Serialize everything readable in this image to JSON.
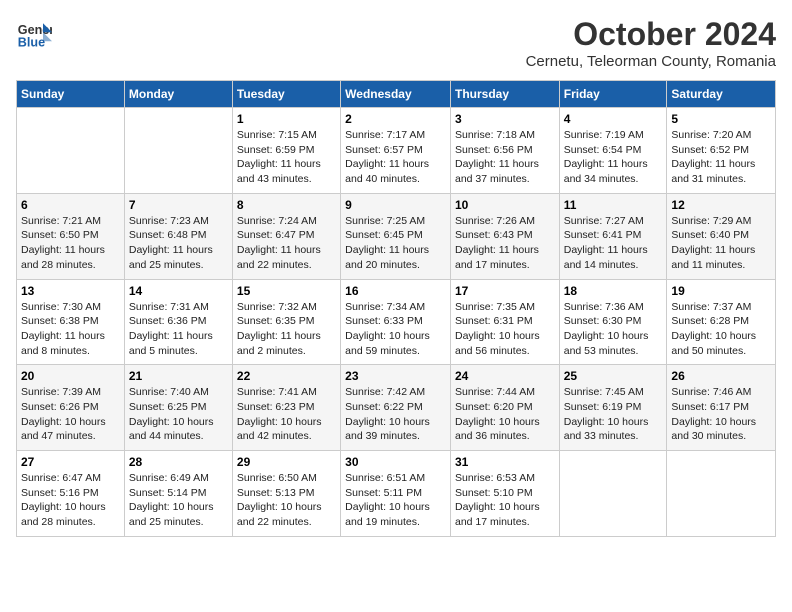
{
  "logo": {
    "line1": "General",
    "line2": "Blue"
  },
  "header": {
    "month": "October 2024",
    "location": "Cernetu, Teleorman County, Romania"
  },
  "weekdays": [
    "Sunday",
    "Monday",
    "Tuesday",
    "Wednesday",
    "Thursday",
    "Friday",
    "Saturday"
  ],
  "weeks": [
    [
      {
        "day": null,
        "info": null
      },
      {
        "day": null,
        "info": null
      },
      {
        "day": "1",
        "info": "Sunrise: 7:15 AM\nSunset: 6:59 PM\nDaylight: 11 hours and 43 minutes."
      },
      {
        "day": "2",
        "info": "Sunrise: 7:17 AM\nSunset: 6:57 PM\nDaylight: 11 hours and 40 minutes."
      },
      {
        "day": "3",
        "info": "Sunrise: 7:18 AM\nSunset: 6:56 PM\nDaylight: 11 hours and 37 minutes."
      },
      {
        "day": "4",
        "info": "Sunrise: 7:19 AM\nSunset: 6:54 PM\nDaylight: 11 hours and 34 minutes."
      },
      {
        "day": "5",
        "info": "Sunrise: 7:20 AM\nSunset: 6:52 PM\nDaylight: 11 hours and 31 minutes."
      }
    ],
    [
      {
        "day": "6",
        "info": "Sunrise: 7:21 AM\nSunset: 6:50 PM\nDaylight: 11 hours and 28 minutes."
      },
      {
        "day": "7",
        "info": "Sunrise: 7:23 AM\nSunset: 6:48 PM\nDaylight: 11 hours and 25 minutes."
      },
      {
        "day": "8",
        "info": "Sunrise: 7:24 AM\nSunset: 6:47 PM\nDaylight: 11 hours and 22 minutes."
      },
      {
        "day": "9",
        "info": "Sunrise: 7:25 AM\nSunset: 6:45 PM\nDaylight: 11 hours and 20 minutes."
      },
      {
        "day": "10",
        "info": "Sunrise: 7:26 AM\nSunset: 6:43 PM\nDaylight: 11 hours and 17 minutes."
      },
      {
        "day": "11",
        "info": "Sunrise: 7:27 AM\nSunset: 6:41 PM\nDaylight: 11 hours and 14 minutes."
      },
      {
        "day": "12",
        "info": "Sunrise: 7:29 AM\nSunset: 6:40 PM\nDaylight: 11 hours and 11 minutes."
      }
    ],
    [
      {
        "day": "13",
        "info": "Sunrise: 7:30 AM\nSunset: 6:38 PM\nDaylight: 11 hours and 8 minutes."
      },
      {
        "day": "14",
        "info": "Sunrise: 7:31 AM\nSunset: 6:36 PM\nDaylight: 11 hours and 5 minutes."
      },
      {
        "day": "15",
        "info": "Sunrise: 7:32 AM\nSunset: 6:35 PM\nDaylight: 11 hours and 2 minutes."
      },
      {
        "day": "16",
        "info": "Sunrise: 7:34 AM\nSunset: 6:33 PM\nDaylight: 10 hours and 59 minutes."
      },
      {
        "day": "17",
        "info": "Sunrise: 7:35 AM\nSunset: 6:31 PM\nDaylight: 10 hours and 56 minutes."
      },
      {
        "day": "18",
        "info": "Sunrise: 7:36 AM\nSunset: 6:30 PM\nDaylight: 10 hours and 53 minutes."
      },
      {
        "day": "19",
        "info": "Sunrise: 7:37 AM\nSunset: 6:28 PM\nDaylight: 10 hours and 50 minutes."
      }
    ],
    [
      {
        "day": "20",
        "info": "Sunrise: 7:39 AM\nSunset: 6:26 PM\nDaylight: 10 hours and 47 minutes."
      },
      {
        "day": "21",
        "info": "Sunrise: 7:40 AM\nSunset: 6:25 PM\nDaylight: 10 hours and 44 minutes."
      },
      {
        "day": "22",
        "info": "Sunrise: 7:41 AM\nSunset: 6:23 PM\nDaylight: 10 hours and 42 minutes."
      },
      {
        "day": "23",
        "info": "Sunrise: 7:42 AM\nSunset: 6:22 PM\nDaylight: 10 hours and 39 minutes."
      },
      {
        "day": "24",
        "info": "Sunrise: 7:44 AM\nSunset: 6:20 PM\nDaylight: 10 hours and 36 minutes."
      },
      {
        "day": "25",
        "info": "Sunrise: 7:45 AM\nSunset: 6:19 PM\nDaylight: 10 hours and 33 minutes."
      },
      {
        "day": "26",
        "info": "Sunrise: 7:46 AM\nSunset: 6:17 PM\nDaylight: 10 hours and 30 minutes."
      }
    ],
    [
      {
        "day": "27",
        "info": "Sunrise: 6:47 AM\nSunset: 5:16 PM\nDaylight: 10 hours and 28 minutes."
      },
      {
        "day": "28",
        "info": "Sunrise: 6:49 AM\nSunset: 5:14 PM\nDaylight: 10 hours and 25 minutes."
      },
      {
        "day": "29",
        "info": "Sunrise: 6:50 AM\nSunset: 5:13 PM\nDaylight: 10 hours and 22 minutes."
      },
      {
        "day": "30",
        "info": "Sunrise: 6:51 AM\nSunset: 5:11 PM\nDaylight: 10 hours and 19 minutes."
      },
      {
        "day": "31",
        "info": "Sunrise: 6:53 AM\nSunset: 5:10 PM\nDaylight: 10 hours and 17 minutes."
      },
      {
        "day": null,
        "info": null
      },
      {
        "day": null,
        "info": null
      }
    ]
  ]
}
